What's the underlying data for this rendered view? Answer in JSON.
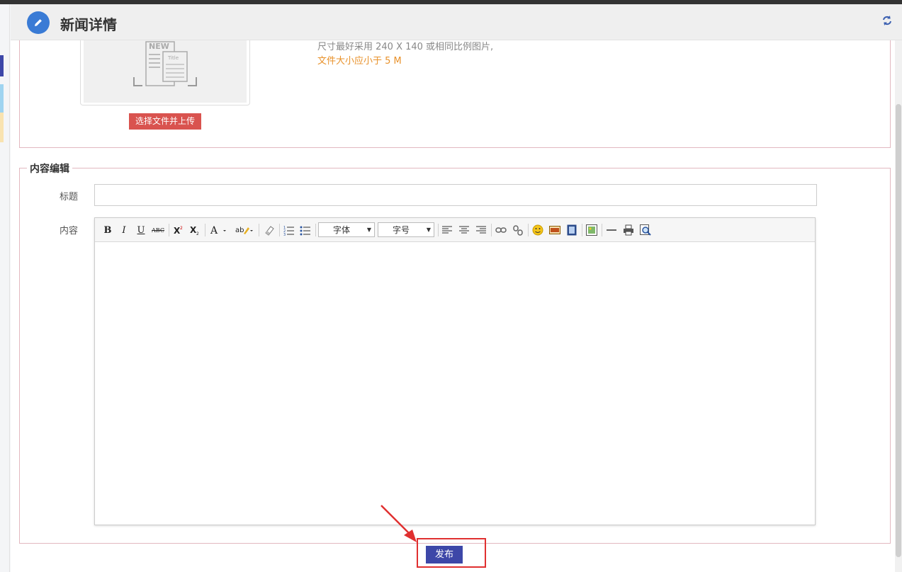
{
  "header": {
    "title": "新闻详情",
    "icon": "pencil-icon",
    "refresh_icon": "refresh-icon"
  },
  "image_upload": {
    "placeholder_text_new": "NEW",
    "placeholder_text_title": "Title",
    "upload_button_label": "选择文件并上传",
    "hint_size": "尺寸最好采用 240 X 140 或相同比例图片,",
    "hint_filesize": "文件大小应小于 5 M"
  },
  "content_edit": {
    "legend": "内容编辑",
    "title_label": "标题",
    "title_value": "",
    "content_label": "内容",
    "toolbar": {
      "bold": "B",
      "italic": "I",
      "underline": "U",
      "strike": "ABC",
      "font_family": "字体",
      "font_size": "字号"
    }
  },
  "publish_button_label": "发布",
  "colors": {
    "accent": "#3d47a8",
    "danger": "#d9534f",
    "hint_orange": "#e8912a",
    "highlight": "#e03030"
  }
}
